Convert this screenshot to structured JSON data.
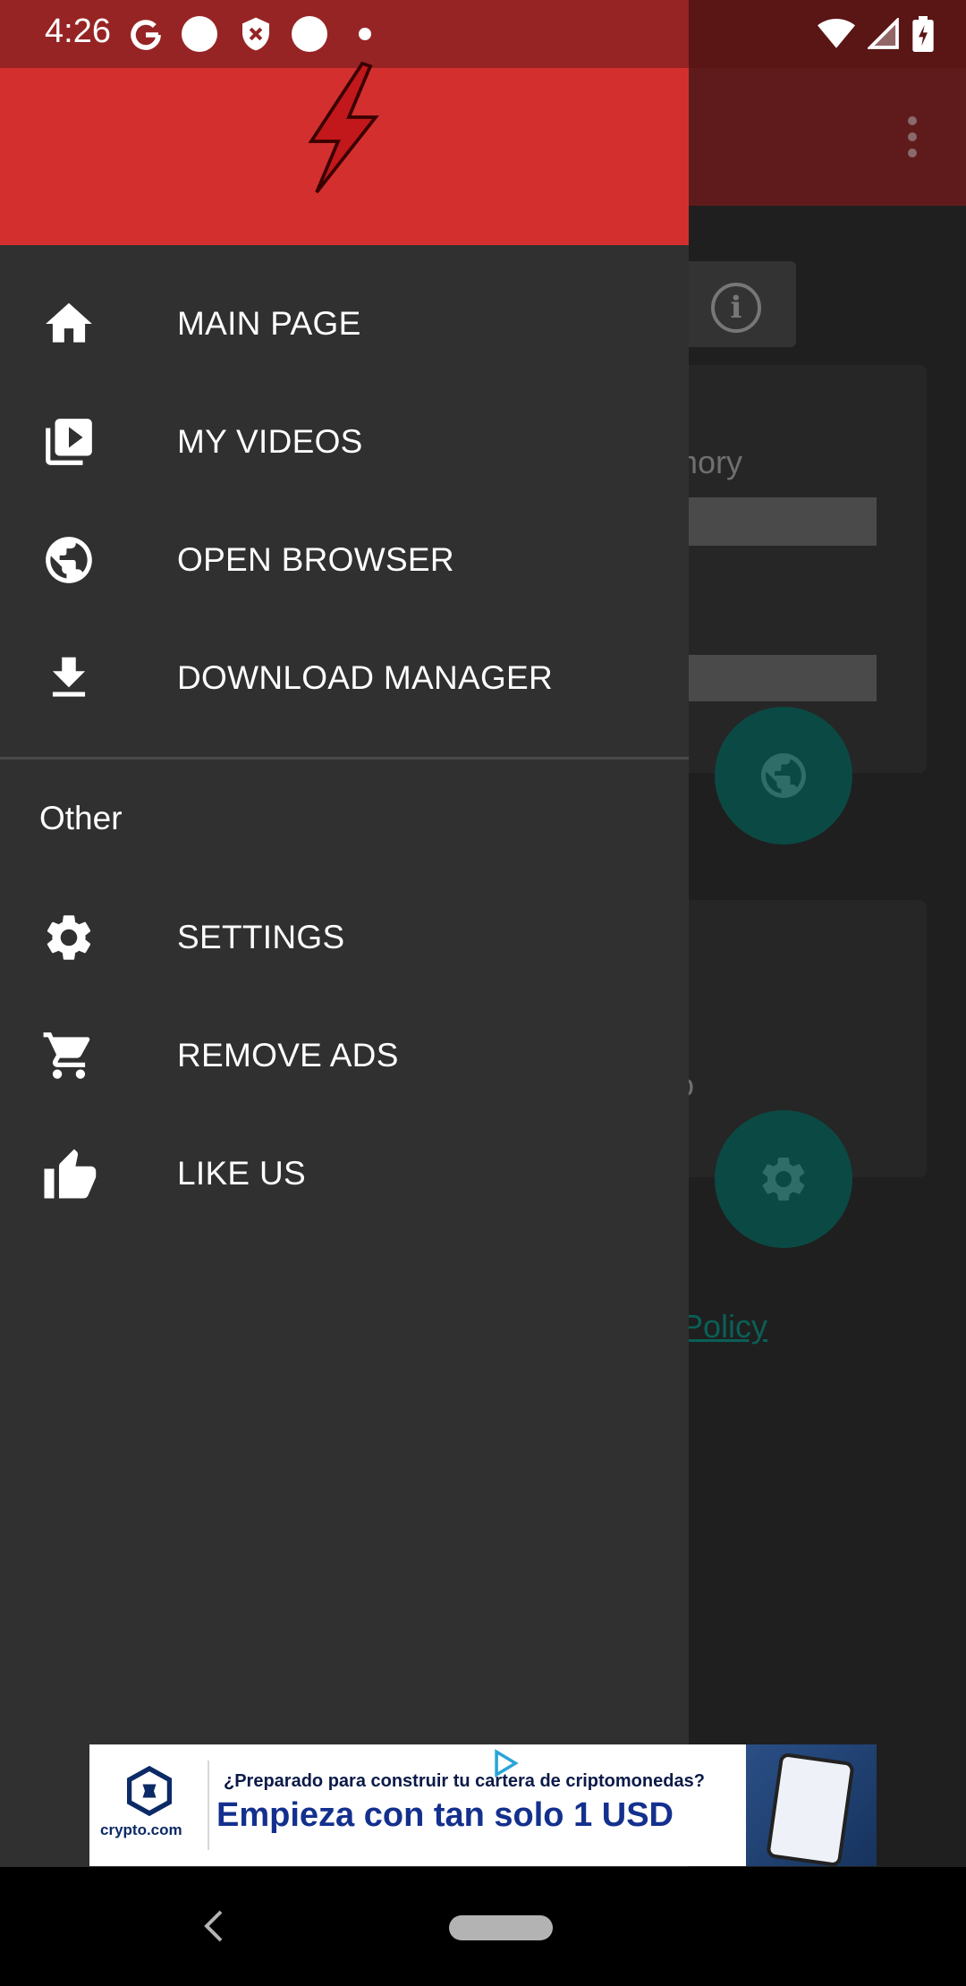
{
  "status_bar": {
    "time": "4:26",
    "icons": [
      "google-icon",
      "circle-icon",
      "shield-icon",
      "circle-icon",
      "dot-icon",
      "wifi-icon",
      "signal-icon",
      "battery-charging-icon"
    ]
  },
  "background": {
    "card1_text": "mory",
    "card2_text": "o",
    "policy_link": "Policy"
  },
  "drawer": {
    "logo_icon": "lightning-bolt-icon",
    "items": [
      {
        "label": "MAIN PAGE",
        "icon": "home-icon"
      },
      {
        "label": "MY VIDEOS",
        "icon": "video-library-icon"
      },
      {
        "label": "OPEN BROWSER",
        "icon": "globe-icon"
      },
      {
        "label": "DOWNLOAD MANAGER",
        "icon": "download-icon"
      }
    ],
    "section_other": "Other",
    "other_items": [
      {
        "label": "SETTINGS",
        "icon": "gear-icon"
      },
      {
        "label": "REMOVE ADS",
        "icon": "cart-icon"
      },
      {
        "label": "LIKE US",
        "icon": "thumbs-up-icon"
      }
    ]
  },
  "ad": {
    "brand": "crypto.com",
    "line1": "¿Preparado para construir tu cartera de criptomonedas?",
    "line2": "Empieza con tan solo 1 USD"
  },
  "colors": {
    "drawer_header": "#d32f2f",
    "drawer_bg": "#303030",
    "status_bar": "#962424",
    "fab": "#0b4a44"
  }
}
